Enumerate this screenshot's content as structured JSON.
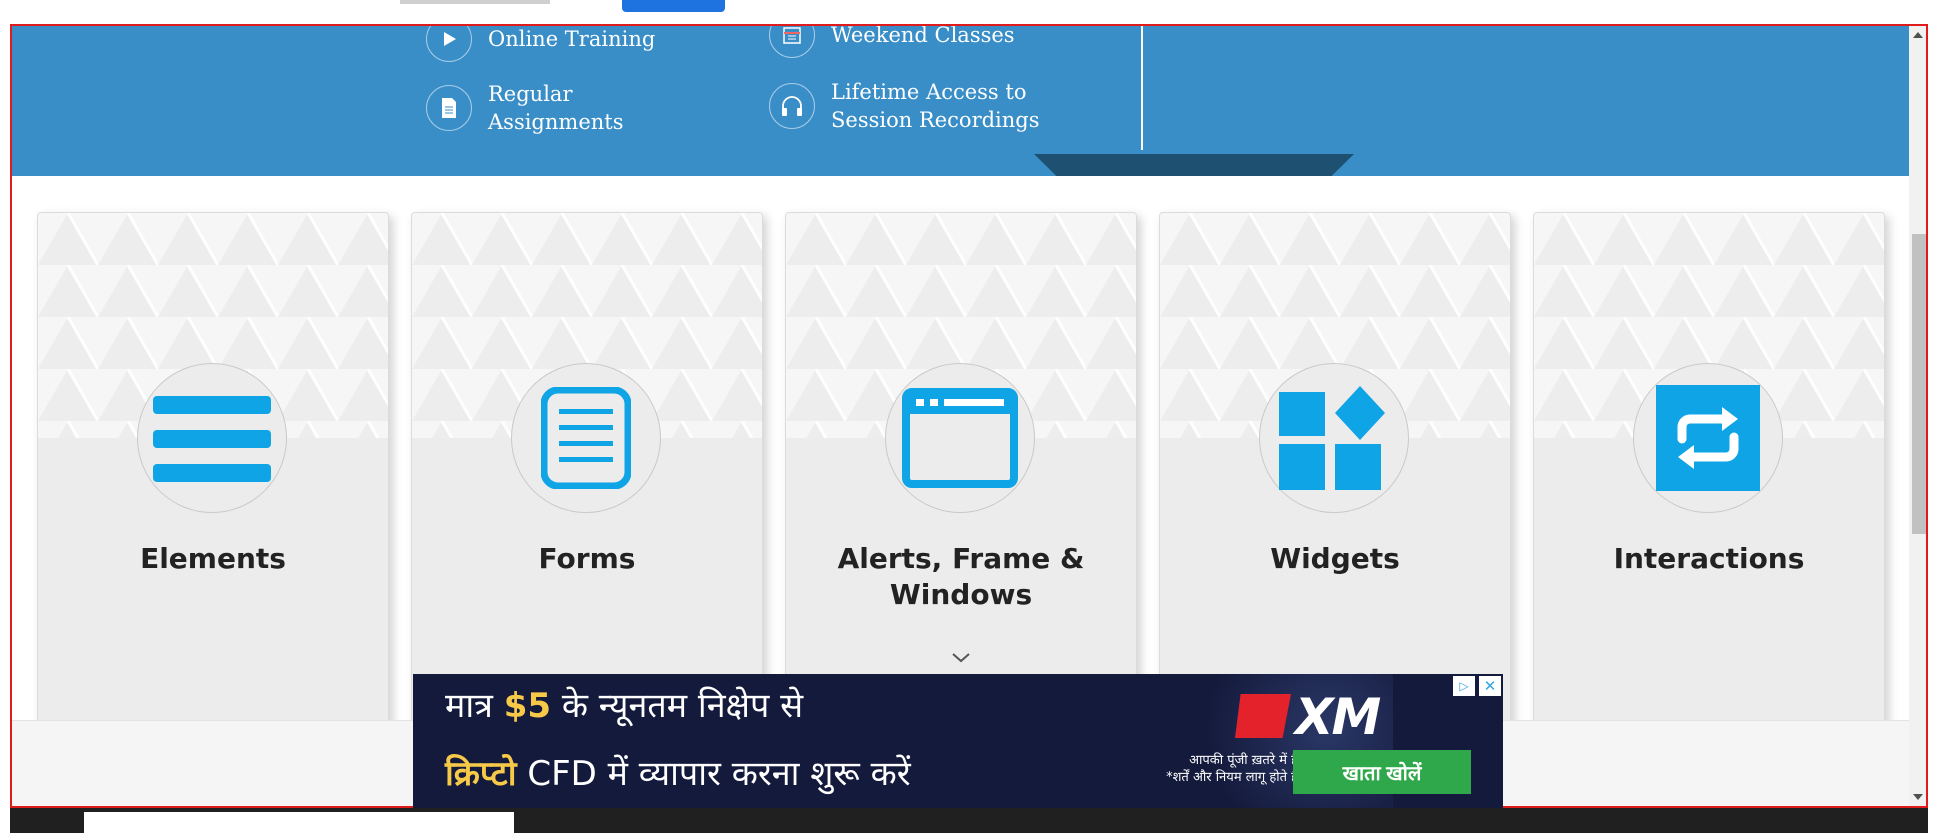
{
  "banner": {
    "features": [
      {
        "label": "Online Training",
        "icon": "play-icon"
      },
      {
        "label": "Weekend Classes",
        "icon": "calendar-icon"
      },
      {
        "label": "Regular\nAssignments",
        "icon": "document-icon"
      },
      {
        "label": "Lifetime Access to\nSession Recordings",
        "icon": "headphones-icon"
      }
    ]
  },
  "cards": [
    {
      "title": "Elements",
      "icon": "menu-icon"
    },
    {
      "title": "Forms",
      "icon": "form-icon"
    },
    {
      "title": "Alerts, Frame & Windows",
      "icon": "window-icon"
    },
    {
      "title": "Widgets",
      "icon": "widgets-icon"
    },
    {
      "title": "Interactions",
      "icon": "interactions-icon"
    }
  ],
  "ad": {
    "line1_pre": "मात्र ",
    "line1_hl": "$5",
    "line1_post": " के न्यूनतम निक्षेप से",
    "line2_hl": "क्रिप्टो",
    "line2_post": " CFD में  व्यापार करना शुरू करें",
    "brand": "XM",
    "disclaimer": "आपकी पूंजी ख़तरे में है।\n*शर्तें और नियम लागू होते हैं।",
    "cta": "खाता खोलें"
  },
  "colors": {
    "banner": "#3a8ec8",
    "icon_blue": "#0ea4e6",
    "frame_border": "#e01b1b"
  }
}
